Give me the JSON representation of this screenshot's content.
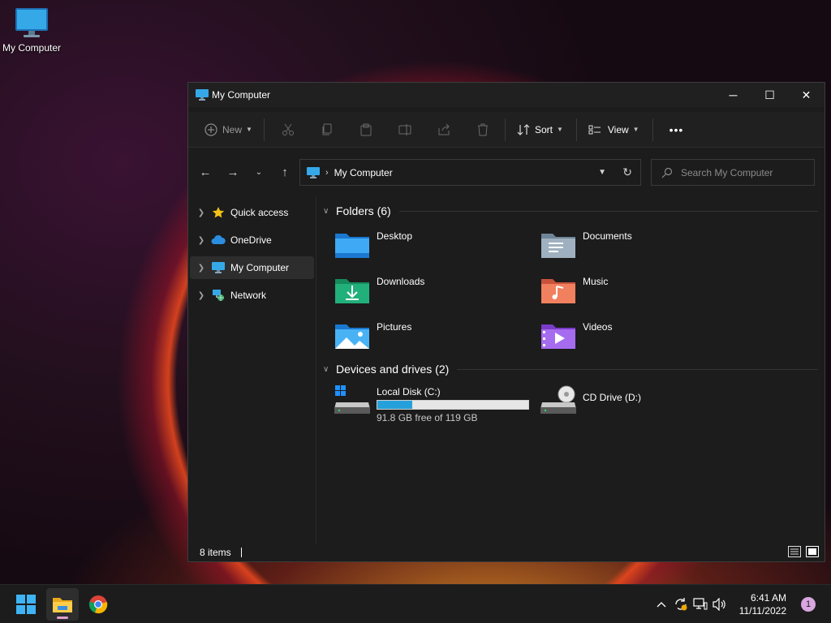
{
  "desktop": {
    "icons": [
      {
        "label": "My Computer",
        "icon": "monitor-icon"
      }
    ]
  },
  "window": {
    "title": "My Computer",
    "controls": {
      "minimize": "─",
      "maximize": "☐",
      "close": "✕"
    }
  },
  "toolbar": {
    "new_label": "New",
    "sort_label": "Sort",
    "view_label": "View",
    "more_label": "•••",
    "icons": [
      "cut-icon",
      "copy-icon",
      "paste-icon",
      "rename-icon",
      "share-icon",
      "delete-icon"
    ]
  },
  "navigation": {
    "back": "←",
    "forward": "→",
    "recent": "⌄",
    "up": "↑",
    "breadcrumb": [
      "My Computer"
    ],
    "search_placeholder": "Search My Computer"
  },
  "sidebar": {
    "items": [
      {
        "label": "Quick access",
        "icon": "star-icon",
        "selected": false
      },
      {
        "label": "OneDrive",
        "icon": "cloud-icon",
        "selected": false
      },
      {
        "label": "My Computer",
        "icon": "monitor-icon",
        "selected": true
      },
      {
        "label": "Network",
        "icon": "network-icon",
        "selected": false
      }
    ]
  },
  "folders": {
    "header": "Folders (6)",
    "items": [
      {
        "name": "Desktop",
        "icon": "desktop-folder-icon"
      },
      {
        "name": "Documents",
        "icon": "documents-folder-icon"
      },
      {
        "name": "Downloads",
        "icon": "downloads-folder-icon"
      },
      {
        "name": "Music",
        "icon": "music-folder-icon"
      },
      {
        "name": "Pictures",
        "icon": "pictures-folder-icon"
      },
      {
        "name": "Videos",
        "icon": "videos-folder-icon"
      }
    ]
  },
  "drives": {
    "header": "Devices and drives (2)",
    "items": [
      {
        "name": "Local Disk (C:)",
        "icon": "hard-drive-icon",
        "free_text": "91.8 GB free of 119 GB",
        "used_fraction": 0.23
      },
      {
        "name": "CD Drive (D:)",
        "icon": "cd-drive-icon"
      }
    ]
  },
  "status": {
    "items_count": "8 items"
  },
  "taskbar": {
    "apps": [
      "start-icon",
      "file-explorer-icon",
      "chrome-icon"
    ],
    "time": "6:41 AM",
    "date": "11/11/2022",
    "notifications": "1"
  },
  "colors": {
    "accent": "#26a0da",
    "window_bg": "#1c1c1c",
    "selected_bg": "#2d2d2d"
  }
}
